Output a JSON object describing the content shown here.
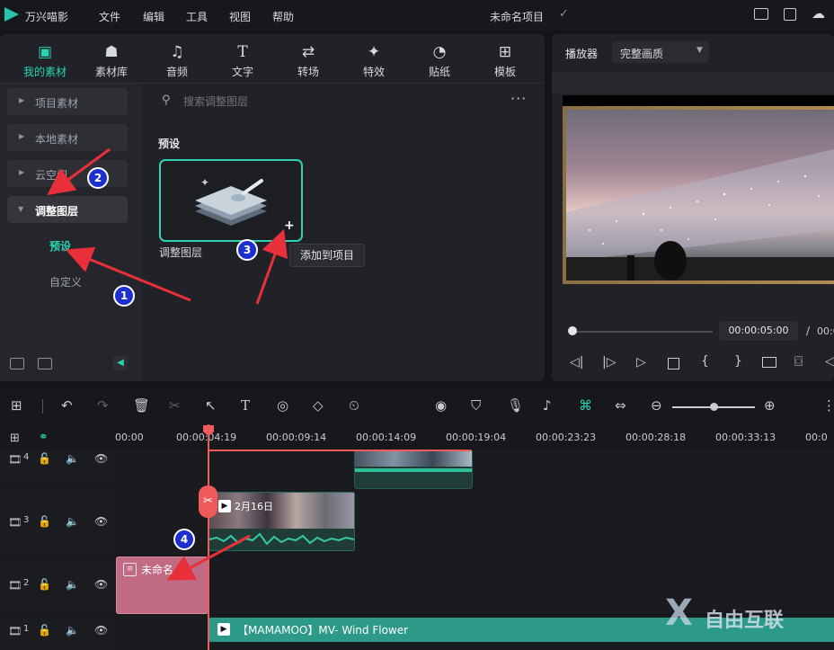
{
  "app": {
    "name": "万兴喵影",
    "project_title": "未命名项目"
  },
  "menu": [
    "文件",
    "编辑",
    "工具",
    "视图",
    "帮助"
  ],
  "tabs": [
    {
      "label": "我的素材",
      "icon": "media-icon"
    },
    {
      "label": "素材库",
      "icon": "library-icon"
    },
    {
      "label": "音频",
      "icon": "music-icon"
    },
    {
      "label": "文字",
      "icon": "text-icon"
    },
    {
      "label": "转场",
      "icon": "transition-icon"
    },
    {
      "label": "特效",
      "icon": "effects-icon"
    },
    {
      "label": "贴纸",
      "icon": "sticker-icon"
    },
    {
      "label": "模板",
      "icon": "template-icon"
    }
  ],
  "sidebar": {
    "items": [
      "项目素材",
      "本地素材",
      "云空间",
      "调整图层"
    ],
    "subitems": [
      "预设",
      "自定义"
    ]
  },
  "search": {
    "placeholder": "搜索调整图层"
  },
  "content": {
    "section_title": "预设",
    "card_label": "调整图层",
    "tooltip": "添加到项目"
  },
  "preview": {
    "label": "播放器",
    "quality": "完整画质",
    "timecode": "00:00:05:00",
    "separator": "/",
    "total_partial": "00:0"
  },
  "timeline": {
    "ticks": [
      "00:00",
      "00:00:04:19",
      "00:00:09:14",
      "00:00:14:09",
      "00:00:19:04",
      "00:00:23:23",
      "00:00:28:18",
      "00:00:33:13",
      "00:0"
    ],
    "tracks": [
      "4",
      "3",
      "2",
      "1"
    ],
    "clips": {
      "video_title": "2月16日",
      "adjust_title": "未命名",
      "audio_title": "【MAMAMOO】MV- Wind Flower"
    }
  },
  "annotations": [
    "1",
    "2",
    "3",
    "4"
  ],
  "watermark": "自由互联",
  "colors": {
    "accent": "#28d3b0",
    "playhead": "#f05a5a",
    "adjust_clip": "#c06a84",
    "audio_clip": "#2c9a86",
    "badge": "#1d2fcf",
    "arrow": "#e8303a"
  }
}
